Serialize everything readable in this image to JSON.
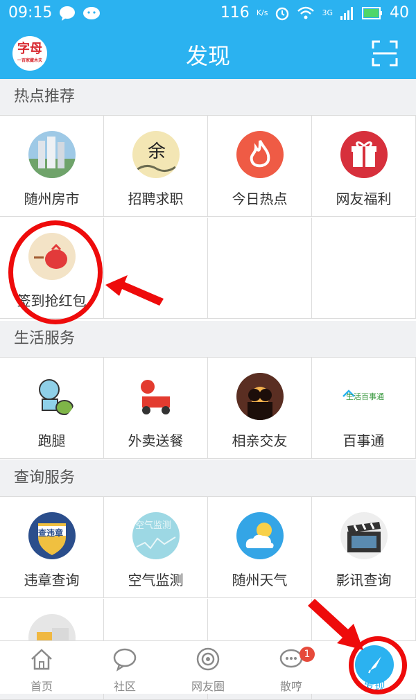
{
  "status_bar": {
    "time": "09:15",
    "speed": "116",
    "speed_unit": "K/s",
    "network": "3G",
    "battery": "40"
  },
  "header": {
    "title": "发现",
    "logo_text": "字母",
    "logo_sub": "一百家藏木夫"
  },
  "sections": [
    {
      "title": "热点推荐",
      "items": [
        {
          "label": "随州房市",
          "icon": "buildings-icon"
        },
        {
          "label": "招聘求职",
          "icon": "calligraphy-icon"
        },
        {
          "label": "今日热点",
          "icon": "flame-icon"
        },
        {
          "label": "网友福利",
          "icon": "gift-icon"
        },
        {
          "label": "签到抢红包",
          "icon": "red-envelope-icon"
        }
      ]
    },
    {
      "title": "生活服务",
      "items": [
        {
          "label": "跑腿",
          "icon": "runner-icon"
        },
        {
          "label": "外卖送餐",
          "icon": "delivery-scooter-icon"
        },
        {
          "label": "相亲交友",
          "icon": "couple-icon"
        },
        {
          "label": "百事通",
          "icon": "house-logo-icon",
          "icon_text": "生活百事通"
        }
      ]
    },
    {
      "title": "查询服务",
      "items": [
        {
          "label": "违章查询",
          "icon": "shield-icon",
          "icon_text": "查违章"
        },
        {
          "label": "空气监测",
          "icon": "air-monitor-icon",
          "icon_text": "空气监测"
        },
        {
          "label": "随州天气",
          "icon": "weather-icon"
        },
        {
          "label": "影讯查询",
          "icon": "clapperboard-icon"
        },
        {
          "label": "",
          "icon": "package-icon"
        }
      ]
    }
  ],
  "bottom_nav": [
    {
      "label": "首页",
      "icon": "home-icon"
    },
    {
      "label": "社区",
      "icon": "chat-bubble-icon"
    },
    {
      "label": "网友圈",
      "icon": "circle-icon"
    },
    {
      "label": "散哼",
      "icon": "message-icon",
      "badge": "1"
    },
    {
      "label": "发现",
      "icon": "compass-icon",
      "active": true
    }
  ],
  "colors": {
    "primary": "#2bb2f0",
    "annotation": "#ee0b0b",
    "badge": "#e64a3b"
  }
}
